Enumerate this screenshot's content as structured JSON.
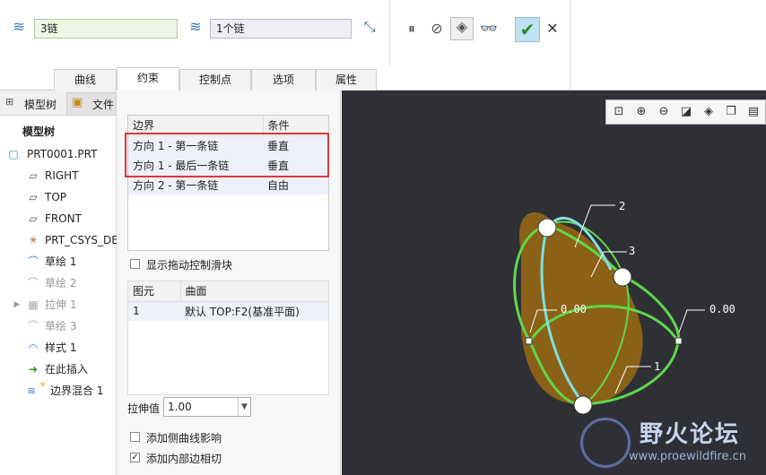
{
  "toolbar": {
    "chain1_value": "3链",
    "chain2_value": "1个链",
    "pause_label": "⏸",
    "no_label": "⊘",
    "preview_label": "◈",
    "glasses_label": "👓",
    "ok_label": "✔",
    "cancel_label": "✕"
  },
  "tabs": [
    {
      "label": "曲线"
    },
    {
      "label": "约束"
    },
    {
      "label": "控制点"
    },
    {
      "label": "选项"
    },
    {
      "label": "属性"
    }
  ],
  "tree": {
    "tab_model": "模型树",
    "tab_file": "文件",
    "header": "模型树",
    "items": [
      {
        "label": "PRT0001.PRT"
      },
      {
        "label": "RIGHT"
      },
      {
        "label": "TOP"
      },
      {
        "label": "FRONT"
      },
      {
        "label": "PRT_CSYS_DEF"
      },
      {
        "label": "草绘 1"
      },
      {
        "label": "草绘 2"
      },
      {
        "label": "拉伸 1"
      },
      {
        "label": "草绘 3"
      },
      {
        "label": "样式 1"
      },
      {
        "label": "在此插入"
      },
      {
        "label": "边界混合 1"
      }
    ]
  },
  "constraints": {
    "col_boundary": "边界",
    "col_condition": "条件",
    "rows": [
      {
        "boundary": "方向 1 - 第一条链",
        "condition": "垂直"
      },
      {
        "boundary": "方向 1 - 最后一条链",
        "condition": "垂直"
      },
      {
        "boundary": "方向 2 - 第一条链",
        "condition": "自由"
      }
    ],
    "show_drag_label": "显示拖动控制滑块",
    "col_element": "图元",
    "col_surface": "曲面",
    "surface_rows": [
      {
        "element": "1",
        "surface": "默认 TOP:F2(基准平面)"
      }
    ],
    "stretch_label": "拉伸值",
    "stretch_value": "1.00",
    "add_side_label": "添加侧曲线影响",
    "add_inner_label": "添加内部边相切"
  },
  "viewport": {
    "label_2": "2",
    "label_3": "3",
    "label_1": "1",
    "dim_left": "0.00",
    "dim_right": "0.00",
    "watermark_title": "野火论坛",
    "watermark_url": "www.proewildfire.cn"
  }
}
